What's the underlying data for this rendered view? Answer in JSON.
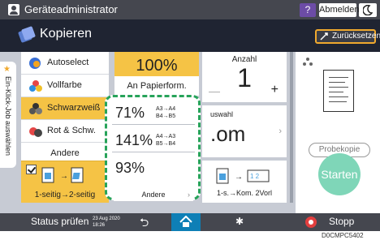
{
  "topbar": {
    "user_label": "Geräteadministrator",
    "help": "?",
    "logout": "Abmelden"
  },
  "titlebar": {
    "app_title": "Kopieren",
    "reset": "Zurücksetzen"
  },
  "side_tab": {
    "label": "Ein-Klick-Job auswählen"
  },
  "color_modes": {
    "items": [
      {
        "label": "Autoselect"
      },
      {
        "label": "Vollfarbe"
      },
      {
        "label": "Schwarzweiß",
        "selected": true
      },
      {
        "label": "Rot & Schw."
      },
      {
        "label": "Andere"
      }
    ]
  },
  "duplex": {
    "label": "1-seitig→2-seitig",
    "checked": true
  },
  "zoom": {
    "value": "100%",
    "paper": "An Papierform."
  },
  "count": {
    "label": "Anzahl",
    "value": "1",
    "plus": "+"
  },
  "sort": {
    "label": "uswahl",
    "value": ".om"
  },
  "orig": {
    "label": "1-s.→Kom. 2Vorl"
  },
  "preview": {
    "preview_btn": "Probekopie",
    "start": "Starten"
  },
  "zoom_popup": {
    "rows": [
      {
        "pct": "71%",
        "map1": "A3→A4",
        "map2": "B4→B5"
      },
      {
        "pct": "141%",
        "map1": "A4→A3",
        "map2": "B5→B4"
      },
      {
        "pct": "93%",
        "map1": "",
        "map2": ""
      }
    ],
    "other": "Andere"
  },
  "bottombar": {
    "status": "Status prüfen",
    "date1": "23 Aug 2020",
    "date2": "18:26",
    "stop": "Stopp"
  },
  "caption": "D0CMPC5402",
  "colors": {
    "accent_yellow": "#f5c345",
    "popup_border": "#27a35a",
    "start_button": "#7fd6b8",
    "home_blue": "#0e7fb6",
    "stop_red": "#e23f3f"
  }
}
